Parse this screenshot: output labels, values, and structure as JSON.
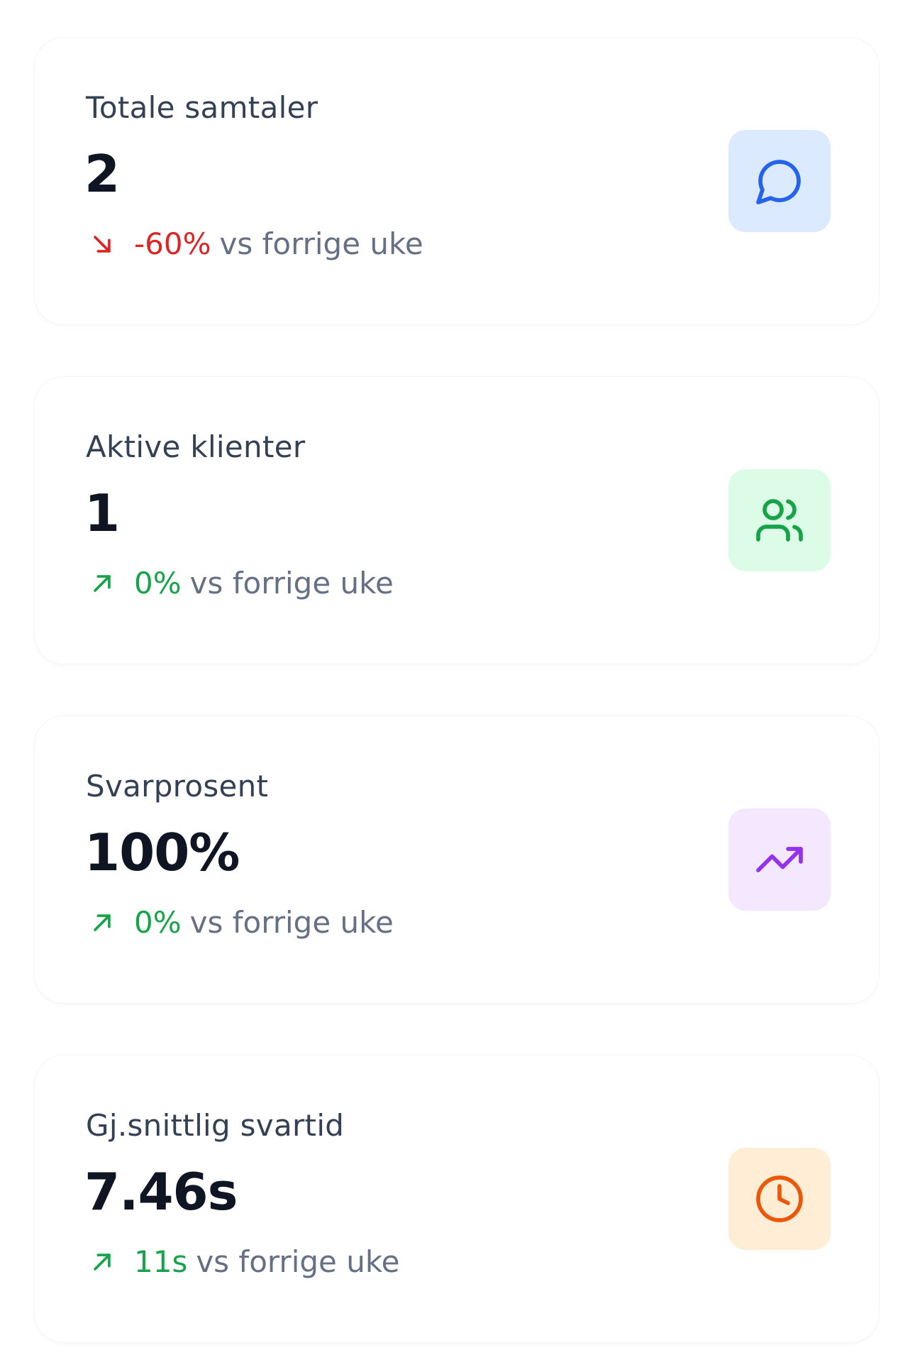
{
  "cards": [
    {
      "label": "Totale samtaler",
      "value": "2",
      "change": "-60%",
      "change_suffix": "vs forrige uke",
      "trend": "down",
      "change_color": "#dc2626",
      "icon": "message-circle-icon",
      "icon_color": "#2563eb",
      "tile_color": "#dbeafe"
    },
    {
      "label": "Aktive klienter",
      "value": "1",
      "change": "0%",
      "change_suffix": "vs forrige uke",
      "trend": "up",
      "change_color": "#16a34a",
      "icon": "users-icon",
      "icon_color": "#16a34a",
      "tile_color": "#dcfce7"
    },
    {
      "label": "Svarprosent",
      "value": "100%",
      "change": "0%",
      "change_suffix": "vs forrige uke",
      "trend": "up",
      "change_color": "#16a34a",
      "icon": "trending-up-icon",
      "icon_color": "#9333ea",
      "tile_color": "#f3e8ff"
    },
    {
      "label": "Gj.snittlig svartid",
      "value": "7.46s",
      "change": "11s",
      "change_suffix": "vs forrige uke",
      "trend": "up",
      "change_color": "#16a34a",
      "icon": "clock-icon",
      "icon_color": "#ea580c",
      "tile_color": "#ffedd5"
    }
  ]
}
